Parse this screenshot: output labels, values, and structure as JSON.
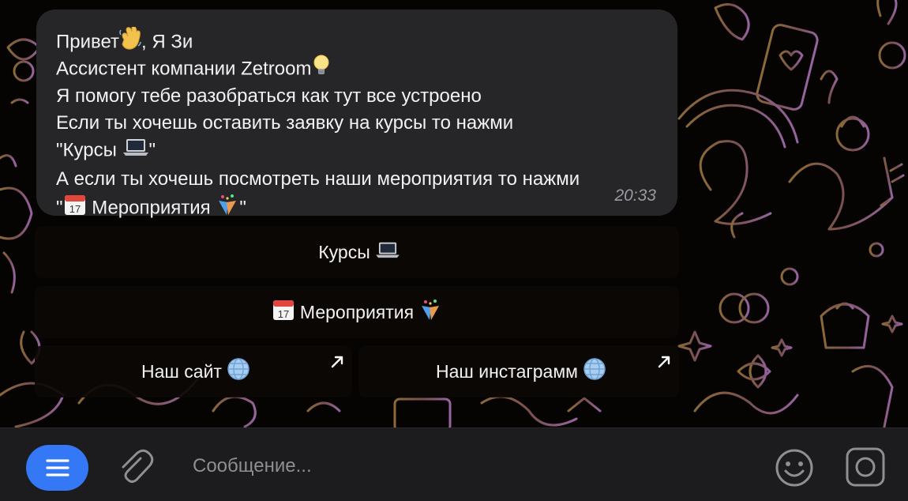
{
  "message": {
    "lines": [
      {
        "text": "Привет",
        "emoji": "waving-hand-icon",
        "suffix": ", Я Зи"
      },
      {
        "text": "Ассистент компании Zetroom",
        "emoji": "light-bulb-icon",
        "suffix": ""
      },
      {
        "text": "Я помогу тебе разобраться как тут все устроено",
        "emoji": "",
        "suffix": ""
      },
      {
        "text": "Если ты хочешь оставить заявку на курсы то нажми",
        "emoji": "",
        "suffix": ""
      },
      {
        "prefix": "\"Курсы ",
        "emoji": "laptop-icon",
        "suffix": "\""
      },
      {
        "text": "А если ты хочешь посмотреть наши мероприятия то нажми",
        "emoji": "",
        "suffix": ""
      },
      {
        "prefix": "\"",
        "emoji_left": "calendar-icon",
        "text": " Мероприятия ",
        "emoji_right": "party-popper-icon",
        "suffix": "\""
      }
    ],
    "time": "20:33"
  },
  "buttons": {
    "courses": {
      "label": "Курсы",
      "icon": "laptop-icon"
    },
    "events": {
      "label": "Мероприятия",
      "icon_left": "calendar-icon",
      "icon_right": "party-popper-icon"
    },
    "site": {
      "label": "Наш сайт",
      "icon": "globe-icon",
      "link_icon": "external-link-arrow-icon"
    },
    "instagram": {
      "label": "Наш инстаграмм",
      "icon": "globe-icon",
      "link_icon": "external-link-arrow-icon"
    }
  },
  "input": {
    "placeholder": "Сообщение...",
    "value": "",
    "menu_icon": "menu-icon",
    "attach_icon": "paperclip-icon",
    "emoji_icon": "smiley-icon",
    "camera_icon": "camera-icon"
  },
  "colors": {
    "bubble": "#262628",
    "accent": "#3478f6",
    "wallpaper_doodle": "#c784d6",
    "wallpaper_doodle_gold": "#b88c4a",
    "input_bar": "#1c1c1e"
  }
}
